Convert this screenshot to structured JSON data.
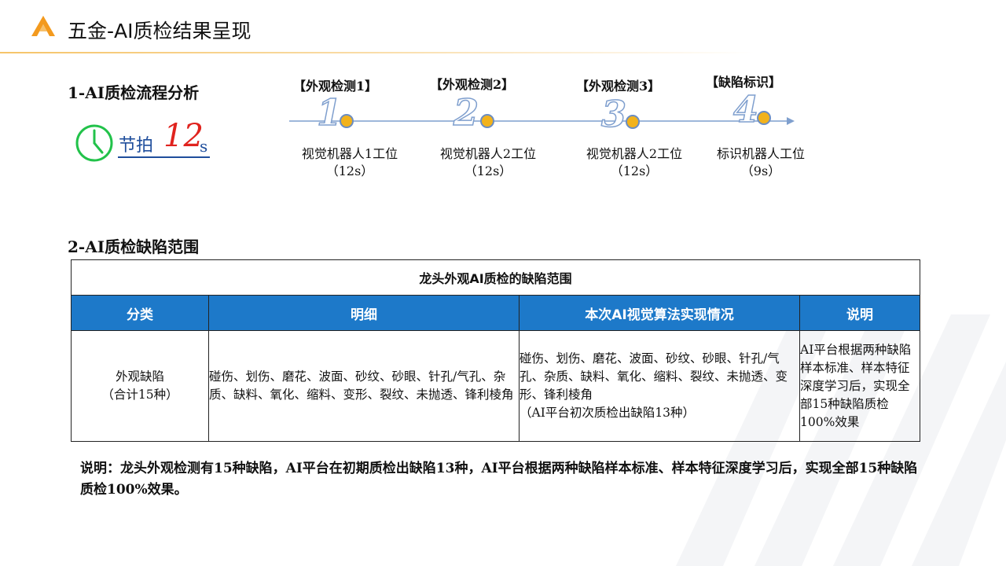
{
  "header": {
    "title": "五金-AI质检结果呈现",
    "logo": "brand-logo-icon"
  },
  "section1": {
    "heading": "1-AI质检流程分析",
    "takt": {
      "label": "节拍",
      "value": "12",
      "unit": "s",
      "icon": "clock-icon"
    },
    "steps": [
      {
        "label": "【外观检测1】",
        "number": "1",
        "station": "视觉机器人1工位",
        "time": "（12s）"
      },
      {
        "label": "【外观检测2】",
        "number": "2",
        "station": "视觉机器人2工位",
        "time": "（12s）"
      },
      {
        "label": "【外观检测3】",
        "number": "3",
        "station": "视觉机器人2工位",
        "time": "（12s）"
      },
      {
        "label": "【缺陷标识】",
        "number": "4",
        "station": "标识机器人工位",
        "time": "（9s）"
      }
    ]
  },
  "section2": {
    "heading": "2-AI质检缺陷范围",
    "table": {
      "title": "龙头外观AI质检的缺陷范围",
      "columns": [
        "分类",
        "明细",
        "本次AI视觉算法实现情况",
        "说明"
      ],
      "row": {
        "category_line1": "外观缺陷",
        "category_line2": "（合计15种）",
        "detail": "碰伤、划伤、磨花、波面、砂纹、砂眼、针孔/气孔、杂质、缺料、氧化、缩料、变形、裂纹、未抛透、锋利棱角",
        "ai_result": "碰伤、划伤、磨花、波面、砂纹、砂眼、针孔/气孔、杂质、缺料、氧化、缩料、裂纹、未抛透、变形、锋利棱角",
        "ai_result_note": "（AI平台初次质检出缺陷13种）",
        "explanation": "AI平台根据两种缺陷样本标准、样本特征深度学习后，实现全部15种缺陷质检100%效果"
      }
    }
  },
  "note": "说明：龙头外观检测有15种缺陷，AI平台在初期质检出缺陷13种，AI平台根据两种缺陷样本标准、样本特征深度学习后，实现全部15种缺陷质检100%效果。",
  "colors": {
    "accent_blue": "#1d79c9",
    "takt_red": "#e0231e",
    "dot_orange": "#f2b21b"
  }
}
